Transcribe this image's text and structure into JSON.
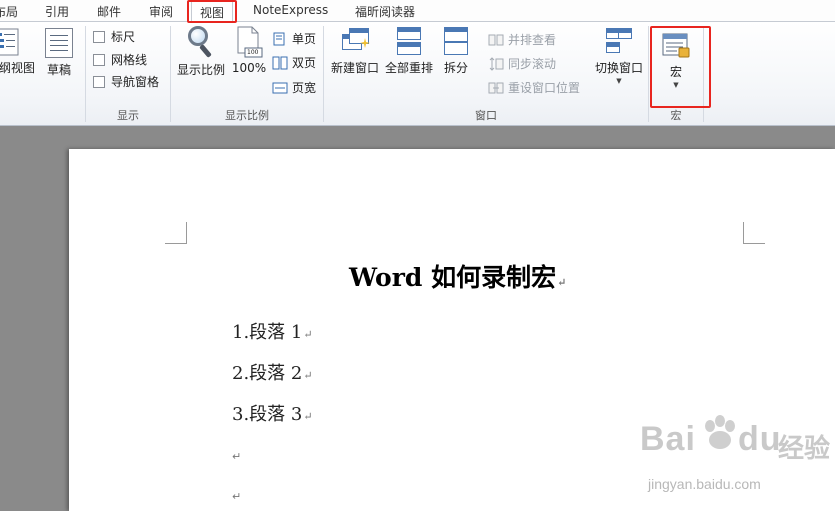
{
  "tabs": [
    {
      "label": "布局"
    },
    {
      "label": "引用"
    },
    {
      "label": "邮件"
    },
    {
      "label": "审阅"
    },
    {
      "label": "视图",
      "active": true
    },
    {
      "label": "NoteExpress"
    },
    {
      "label": "福昕阅读器"
    }
  ],
  "ribbon": {
    "views": {
      "outline": "纲视图",
      "draft": "草稿"
    },
    "show": {
      "label": "显示",
      "items": [
        {
          "label": "标尺",
          "checked": false
        },
        {
          "label": "网格线",
          "checked": false
        },
        {
          "label": "导航窗格",
          "checked": false
        }
      ]
    },
    "zoom": {
      "label": "显示比例",
      "zoom_button": "显示比例",
      "percent_button": "100%",
      "percent_icon_text": "100",
      "one_page": "单页",
      "two_pages": "双页",
      "page_width": "页宽"
    },
    "window": {
      "label": "窗口",
      "new_window": "新建窗口",
      "arrange_all": "全部重排",
      "split": "拆分",
      "side_by_side": "并排查看",
      "sync_scroll": "同步滚动",
      "reset_position": "重设窗口位置",
      "switch_windows": "切换窗口"
    },
    "macros": {
      "label": "宏",
      "button": "宏"
    }
  },
  "document": {
    "title": "Word 如何录制宏",
    "paragraphs": [
      "1.段落 1",
      "2.段落 2",
      "3.段落 3"
    ],
    "paragraph_mark": "↵"
  },
  "watermark": {
    "brand": "Bai",
    "brand_suffix": "du",
    "brand_cn": "经验",
    "url": "jingyan.baidu.com"
  },
  "colors": {
    "highlight": "#e8251f",
    "ribbon_bg": "#f4f6f9",
    "workspace": "#8a8a8a"
  }
}
